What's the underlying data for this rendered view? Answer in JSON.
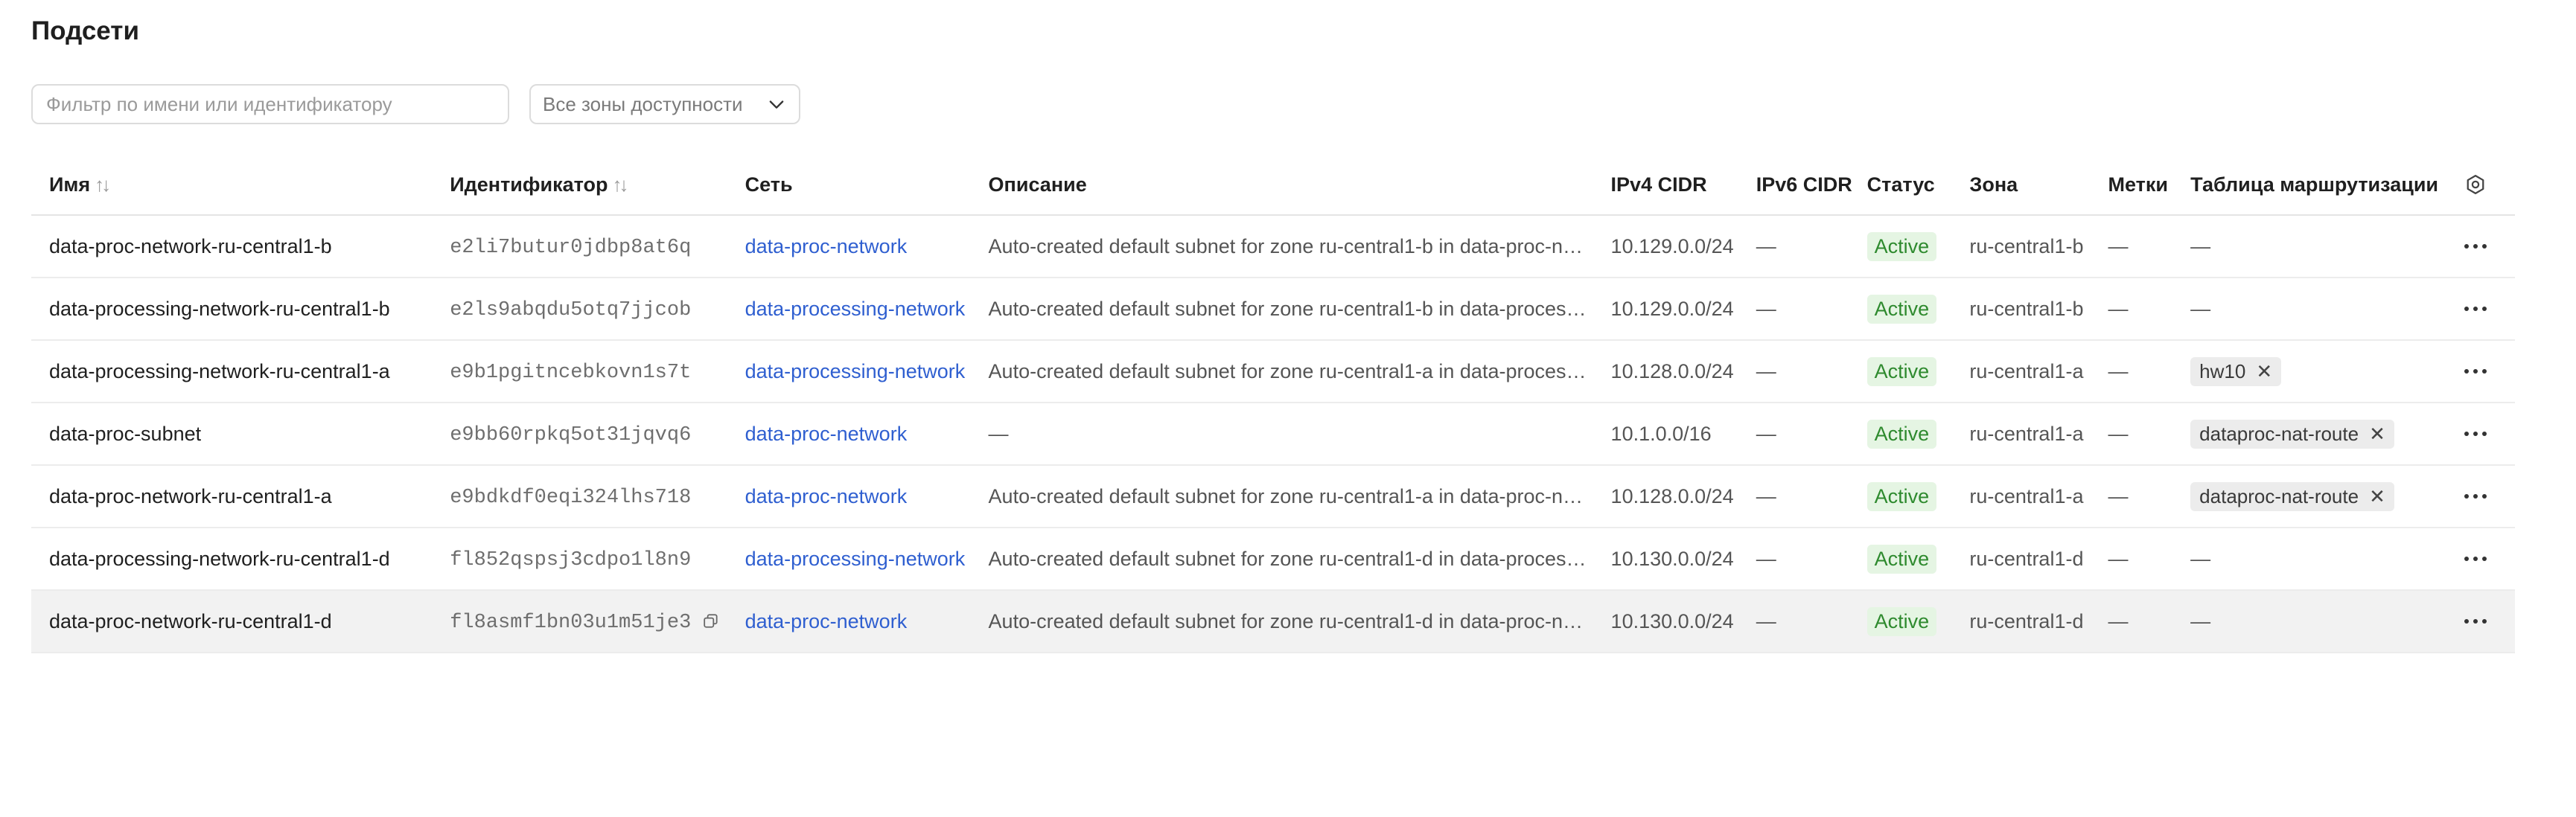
{
  "page": {
    "title": "Подсети"
  },
  "filters": {
    "search_placeholder": "Фильтр по имени или идентификатору",
    "zone_select_value": "Все зоны доступности"
  },
  "table": {
    "columns": {
      "name": "Имя",
      "id": "Идентификатор",
      "network": "Сеть",
      "description": "Описание",
      "ipv4": "IPv4 CIDR",
      "ipv6": "IPv6 CIDR",
      "status": "Статус",
      "zone": "Зона",
      "labels": "Метки",
      "route_table": "Таблица маршрутизации"
    },
    "rows": [
      {
        "name": "data-proc-network-ru-central1-b",
        "id": "e2li7butur0jdbp8at6q",
        "network": "data-proc-network",
        "description": "Auto-created default subnet for zone ru-central1-b in data-proc-network",
        "ipv4": "10.129.0.0/24",
        "ipv6": "—",
        "status": "Active",
        "zone": "ru-central1-b",
        "labels": "—",
        "route_table": "—"
      },
      {
        "name": "data-processing-network-ru-central1-b",
        "id": "e2ls9abqdu5otq7jjcob",
        "network": "data-processing-network",
        "description": "Auto-created default subnet for zone ru-central1-b in data-processing-network",
        "ipv4": "10.129.0.0/24",
        "ipv6": "—",
        "status": "Active",
        "zone": "ru-central1-b",
        "labels": "—",
        "route_table": "—"
      },
      {
        "name": "data-processing-network-ru-central1-a",
        "id": "e9b1pgitncebkovn1s7t",
        "network": "data-processing-network",
        "description": "Auto-created default subnet for zone ru-central1-a in data-processing-network",
        "ipv4": "10.128.0.0/24",
        "ipv6": "—",
        "status": "Active",
        "zone": "ru-central1-a",
        "labels": "—",
        "route_table": "hw10"
      },
      {
        "name": "data-proc-subnet",
        "id": "e9bb60rpkq5ot31jqvq6",
        "network": "data-proc-network",
        "description": "—",
        "ipv4": "10.1.0.0/16",
        "ipv6": "—",
        "status": "Active",
        "zone": "ru-central1-a",
        "labels": "—",
        "route_table": "dataproc-nat-route"
      },
      {
        "name": "data-proc-network-ru-central1-a",
        "id": "e9bdkdf0eqi324lhs718",
        "network": "data-proc-network",
        "description": "Auto-created default subnet for zone ru-central1-a in data-proc-network",
        "ipv4": "10.128.0.0/24",
        "ipv6": "—",
        "status": "Active",
        "zone": "ru-central1-a",
        "labels": "—",
        "route_table": "dataproc-nat-route"
      },
      {
        "name": "data-processing-network-ru-central1-d",
        "id": "fl852qspsj3cdpo1l8n9",
        "network": "data-processing-network",
        "description": "Auto-created default subnet for zone ru-central1-d in data-processing-network",
        "ipv4": "10.130.0.0/24",
        "ipv6": "—",
        "status": "Active",
        "zone": "ru-central1-d",
        "labels": "—",
        "route_table": "—"
      },
      {
        "name": "data-proc-network-ru-central1-d",
        "id": "fl8asmf1bn03u1m51je3",
        "network": "data-proc-network",
        "description": "Auto-created default subnet for zone ru-central1-d in data-proc-network",
        "ipv4": "10.130.0.0/24",
        "ipv6": "—",
        "status": "Active",
        "zone": "ru-central1-d",
        "labels": "—",
        "route_table": "—"
      }
    ]
  },
  "icons": {
    "sort": "sort-icon",
    "gear": "gear-icon",
    "chevron": "chevron-down-icon",
    "more": "more-icon",
    "copy": "copy-icon",
    "close": "close-icon"
  },
  "colors": {
    "link": "#2f5fd0",
    "status_bg": "#e5f5e3",
    "status_text": "#2e8a2e"
  }
}
